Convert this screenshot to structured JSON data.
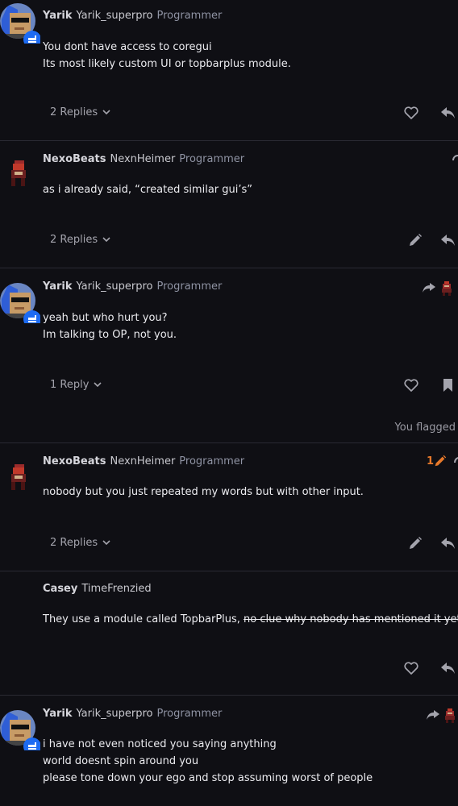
{
  "posts": [
    {
      "author_display": "Yarik",
      "author_username": "Yarik_superpro",
      "author_title": "Programmer",
      "body": [
        "You dont have access to coregui",
        "Its most likely custom UI or topbarplus module."
      ],
      "replies_label": "2 Replies"
    },
    {
      "author_display": "NexoBeats",
      "author_username": "NexnHeimer",
      "author_title": "Programmer",
      "body": [
        "as i already said, “created similar gui’s”"
      ],
      "replies_label": "2 Replies"
    },
    {
      "author_display": "Yarik",
      "author_username": "Yarik_superpro",
      "author_title": "Programmer",
      "body": [
        "yeah but who hurt you?",
        "Im talking to OP, not you."
      ],
      "replies_label": "1 Reply",
      "flag_status": "You flagged"
    },
    {
      "author_display": "NexoBeats",
      "author_username": "NexnHeimer",
      "author_title": "Programmer",
      "edit_count": "1",
      "body": [
        "nobody but you just repeated my words but with other input."
      ],
      "replies_label": "2 Replies"
    },
    {
      "author_display": "Casey",
      "author_username": "TimeFrenzied",
      "body_plain": "They use a module called TopbarPlus, ",
      "body_struck": "no clue why nobody has mentioned it yet."
    },
    {
      "author_display": "Yarik",
      "author_username": "Yarik_superpro",
      "author_title": "Programmer",
      "body": [
        "i have not even noticed you saying anything",
        "world doesnt spin around you",
        "please tone down your ego and stop assuming worst of people"
      ]
    }
  ],
  "icons": {
    "like": "heart-icon",
    "reply": "reply-icon",
    "edit": "pencil-icon",
    "bookmark": "bookmark-icon",
    "expand": "chevron-down-icon",
    "reply_to": "reply-arrow-icon"
  },
  "colors": {
    "background": "#0f0f14",
    "title": "#8f93a3",
    "badge": "#1d6bf2",
    "edit_accent": "#e7792b"
  }
}
